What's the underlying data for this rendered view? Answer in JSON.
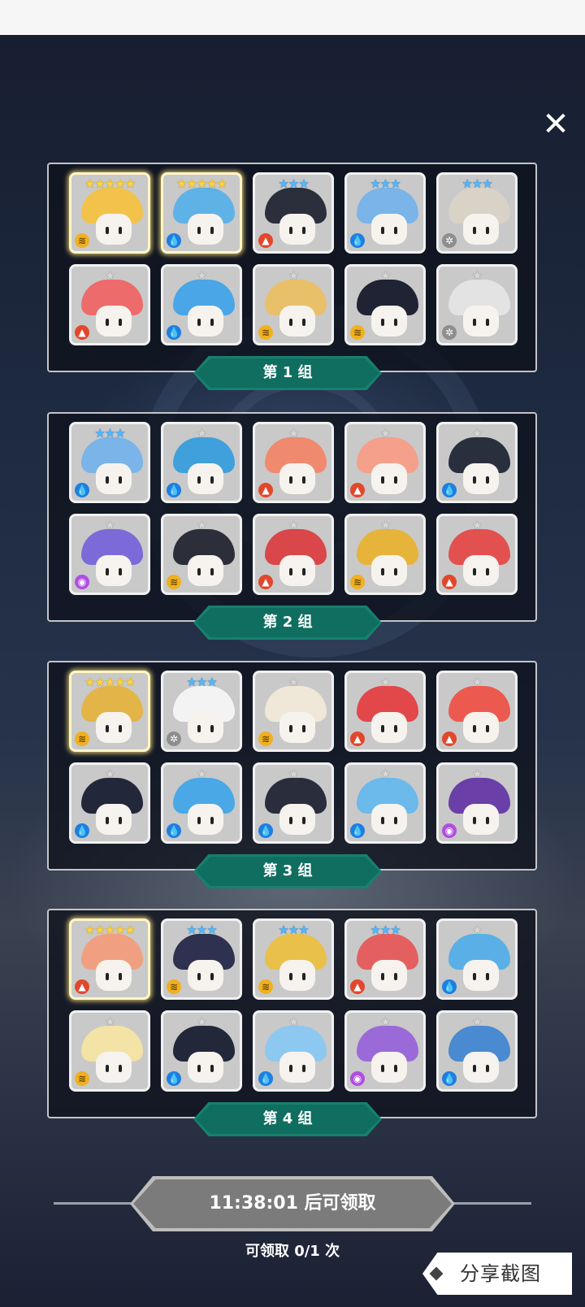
{
  "close_icon": "close-icon",
  "groups": [
    {
      "label": "第 1 组",
      "heroes": [
        {
          "stars": "★★★★★",
          "rarity": "gold",
          "element": "wind",
          "hair": "#f2c24a"
        },
        {
          "stars": "★★★★★",
          "rarity": "gold",
          "element": "water",
          "hair": "#5fb2e6"
        },
        {
          "stars": "★★★",
          "rarity": "blue",
          "element": "fire",
          "hair": "#2b2f3b"
        },
        {
          "stars": "★★★",
          "rarity": "blue",
          "element": "water",
          "hair": "#7ab4e8"
        },
        {
          "stars": "★★★",
          "rarity": "blue",
          "element": "gear",
          "hair": "#d9d2c6"
        },
        {
          "stars": "★",
          "rarity": "grey",
          "element": "fire",
          "hair": "#ee6b6b"
        },
        {
          "stars": "★",
          "rarity": "grey",
          "element": "water",
          "hair": "#4aa6e6"
        },
        {
          "stars": "★",
          "rarity": "grey",
          "element": "wind",
          "hair": "#e9c06a"
        },
        {
          "stars": "★",
          "rarity": "grey",
          "element": "wind",
          "hair": "#1f2333"
        },
        {
          "stars": "★",
          "rarity": "grey",
          "element": "gear",
          "hair": "#e3e3e3"
        }
      ]
    },
    {
      "label": "第 2 组",
      "heroes": [
        {
          "stars": "★★★",
          "rarity": "blue",
          "element": "water",
          "hair": "#7ab4e8"
        },
        {
          "stars": "★",
          "rarity": "grey",
          "element": "water",
          "hair": "#3fa0dc"
        },
        {
          "stars": "★",
          "rarity": "grey",
          "element": "fire",
          "hair": "#f08a6e"
        },
        {
          "stars": "★",
          "rarity": "grey",
          "element": "fire",
          "hair": "#f4a08a"
        },
        {
          "stars": "★",
          "rarity": "grey",
          "element": "water",
          "hair": "#2a2f3d"
        },
        {
          "stars": "★",
          "rarity": "grey",
          "element": "arcane",
          "hair": "#7c6ad8"
        },
        {
          "stars": "★",
          "rarity": "grey",
          "element": "wind",
          "hair": "#2c2f3a"
        },
        {
          "stars": "★",
          "rarity": "grey",
          "element": "fire",
          "hair": "#d9474a"
        },
        {
          "stars": "★",
          "rarity": "grey",
          "element": "wind",
          "hair": "#e6b43a"
        },
        {
          "stars": "★",
          "rarity": "grey",
          "element": "fire",
          "hair": "#e35050"
        }
      ]
    },
    {
      "label": "第 3 组",
      "heroes": [
        {
          "stars": "★★★★★",
          "rarity": "gold",
          "element": "wind",
          "hair": "#e3b548"
        },
        {
          "stars": "★★★",
          "rarity": "blue",
          "element": "gear",
          "hair": "#f3f3f3"
        },
        {
          "stars": "★",
          "rarity": "grey",
          "element": "wind",
          "hair": "#efe8d8"
        },
        {
          "stars": "★",
          "rarity": "grey",
          "element": "fire",
          "hair": "#e2474a"
        },
        {
          "stars": "★",
          "rarity": "grey",
          "element": "fire",
          "hair": "#ec5a4f"
        },
        {
          "stars": "★",
          "rarity": "grey",
          "element": "water",
          "hair": "#23273a"
        },
        {
          "stars": "★",
          "rarity": "grey",
          "element": "water",
          "hair": "#4aa8e6"
        },
        {
          "stars": "★",
          "rarity": "grey",
          "element": "water",
          "hair": "#2a2e3c"
        },
        {
          "stars": "★",
          "rarity": "grey",
          "element": "water",
          "hair": "#6cb9ec"
        },
        {
          "stars": "★",
          "rarity": "grey",
          "element": "arcane",
          "hair": "#6a3fa8"
        }
      ]
    },
    {
      "label": "第 4 组",
      "heroes": [
        {
          "stars": "★★★★★",
          "rarity": "gold",
          "element": "fire",
          "hair": "#f0a080"
        },
        {
          "stars": "★★★",
          "rarity": "blue",
          "element": "wind",
          "hair": "#2f3150"
        },
        {
          "stars": "★★★",
          "rarity": "blue",
          "element": "wind",
          "hair": "#e8c04a"
        },
        {
          "stars": "★★★",
          "rarity": "blue",
          "element": "fire",
          "hair": "#e46060"
        },
        {
          "stars": "★",
          "rarity": "grey",
          "element": "water",
          "hair": "#5ab0e6"
        },
        {
          "stars": "★",
          "rarity": "grey",
          "element": "wind",
          "hair": "#f4e3a6"
        },
        {
          "stars": "★",
          "rarity": "grey",
          "element": "water",
          "hair": "#23273a"
        },
        {
          "stars": "★",
          "rarity": "grey",
          "element": "water",
          "hair": "#8cc8f0"
        },
        {
          "stars": "★",
          "rarity": "grey",
          "element": "arcane",
          "hair": "#9a6ad8"
        },
        {
          "stars": "★",
          "rarity": "grey",
          "element": "water",
          "hair": "#4a8ad0"
        }
      ]
    }
  ],
  "element_glyphs": {
    "water": "💧",
    "fire": "▲",
    "wind": "≋",
    "gear": "✲",
    "arcane": "◉"
  },
  "claim": {
    "button_label": "11:38:01 后可领取",
    "count_text": "可领取 0/1 次"
  },
  "share": {
    "label": "分享截图"
  }
}
